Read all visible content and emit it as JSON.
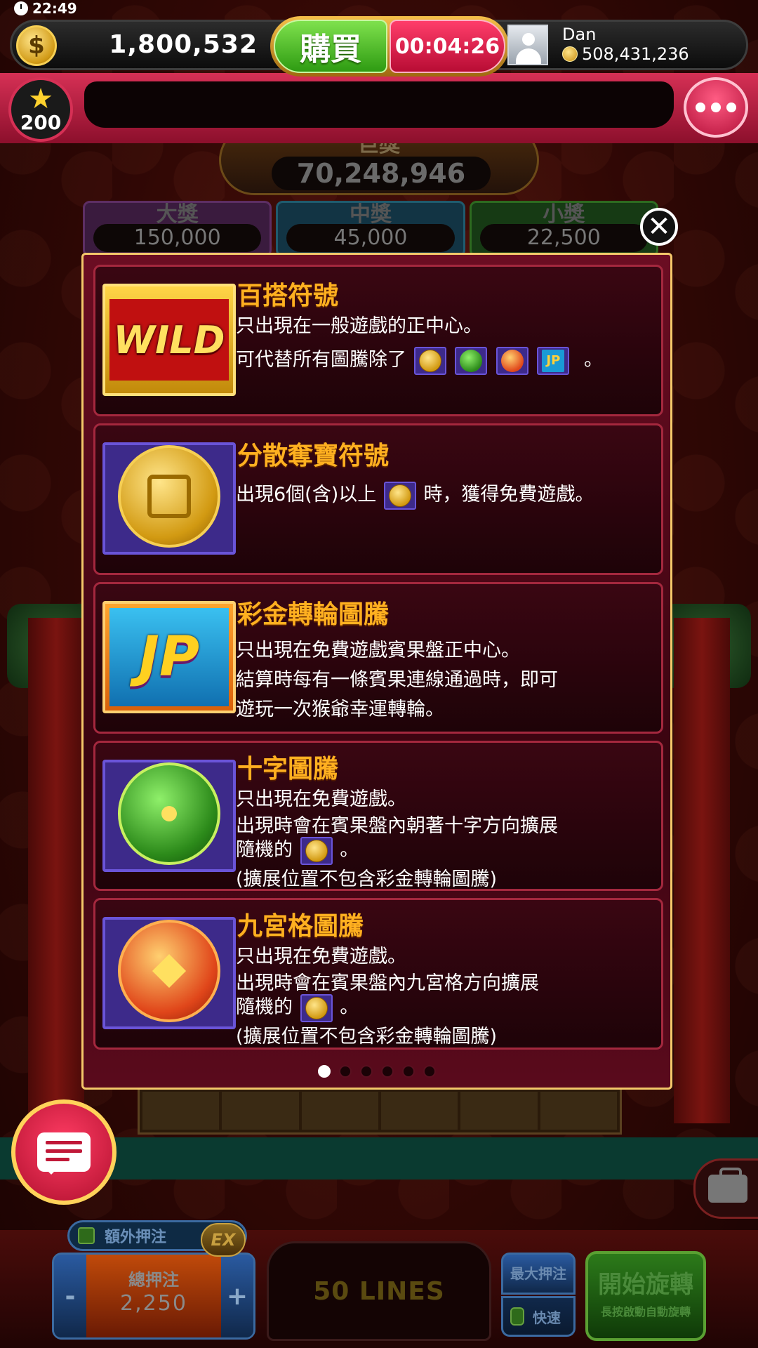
{
  "status": {
    "time": "22:49"
  },
  "topbar": {
    "balance": "1,800,532",
    "buy_label": "購買",
    "timer": "00:04:26",
    "username": "Dan",
    "user_coins": "508,431,236",
    "coin_symbol": "$"
  },
  "level": {
    "value": "200"
  },
  "jackpots": {
    "grand": {
      "label": "巨獎",
      "value": "70,248,946"
    },
    "major": {
      "label": "大獎",
      "value": "150,000"
    },
    "minor": {
      "label": "中獎",
      "value": "45,000"
    },
    "mini": {
      "label": "小獎",
      "value": "22,500"
    }
  },
  "dialog": {
    "cards": [
      {
        "symbol": "WILD",
        "title": "百搭符號",
        "lines": [
          "只出現在一般遊戲的正中心。",
          "可代替所有圖騰除了",
          "。"
        ]
      },
      {
        "symbol": "scatter-coin",
        "title": "分散奪寶符號",
        "lines": [
          "出現6個(含)以上",
          "時，獲得免費遊戲。"
        ]
      },
      {
        "symbol": "JP",
        "title": "彩金轉輪圖騰",
        "lines": [
          "只出現在免費遊戲賓果盤正中心。",
          "結算時每有一條賓果連線通過時，即可",
          "遊玩一次猴爺幸運轉輪。"
        ]
      },
      {
        "symbol": "cross-totem",
        "title": "十字圖騰",
        "lines": [
          "只出現在免費遊戲。",
          "出現時會在賓果盤內朝著十字方向擴展",
          "隨機的",
          "。",
          "(擴展位置不包含彩金轉輪圖騰)"
        ]
      },
      {
        "symbol": "grid-totem",
        "title": "九宮格圖騰",
        "lines": [
          "只出現在免費遊戲。",
          "出現時會在賓果盤內九宮格方向擴展",
          "隨機的",
          "。",
          "(擴展位置不包含彩金轉輪圖騰)"
        ]
      }
    ],
    "pagination": {
      "total": 6,
      "active": 1
    }
  },
  "controls": {
    "extra_bet_label": "額外押注",
    "ex_badge": "EX",
    "total_bet_label": "總押注",
    "total_bet_value": "2,250",
    "minus": "-",
    "plus": "+",
    "lines_label": "50 LINES",
    "max_bet_label": "最大押注",
    "fast_label": "快速",
    "spin_label": "開始旋轉",
    "spin_sub": "長按啟動自動旋轉"
  },
  "colors": {
    "title_accent": "#ffb020",
    "dialog_border": "#f4c86a",
    "card_border": "#a4283e",
    "buy_green": "#2e9b12",
    "timer_red": "#b80c34"
  }
}
